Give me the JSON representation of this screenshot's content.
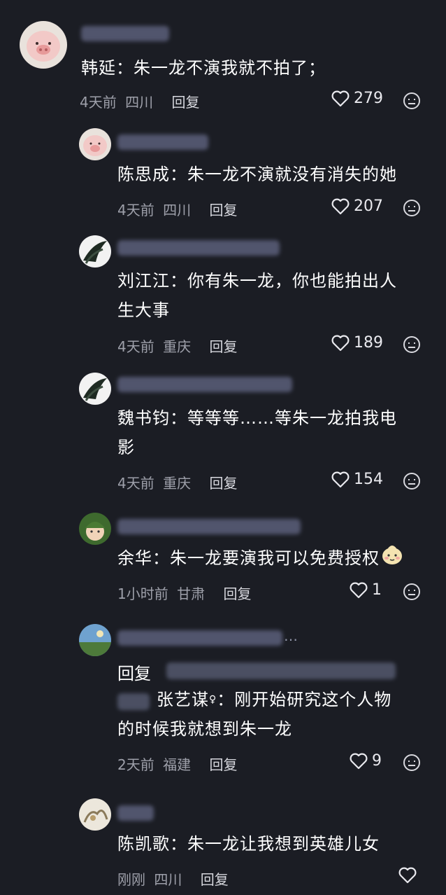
{
  "comments": [
    {
      "id": "c1",
      "text": "韩延：朱一龙不演我就不拍了；",
      "time": "4天前",
      "location": "四川",
      "reply": "回复",
      "likes": "279"
    },
    {
      "id": "c2",
      "text": "陈思成：朱一龙不演就没有消失的她",
      "time": "4天前",
      "location": "四川",
      "reply": "回复",
      "likes": "207"
    },
    {
      "id": "c3",
      "text_line1": "刘江江：你有朱一龙，你也能拍出人",
      "text_line2": "生大事",
      "time": "4天前",
      "location": "重庆",
      "reply": "回复",
      "likes": "189"
    },
    {
      "id": "c4",
      "text_line1": "魏书钧：等等等……等朱一龙拍我电",
      "text_line2": "影",
      "time": "4天前",
      "location": "重庆",
      "reply": "回复",
      "likes": "154"
    },
    {
      "id": "c5",
      "text": "余华：朱一龙要演我可以免费授权",
      "time": "1小时前",
      "location": "甘肃",
      "reply": "回复",
      "likes": "1"
    },
    {
      "id": "c6",
      "reply_prefix": "回复",
      "name": "张艺谋",
      "text_line1": "：刚开始研究这个人物",
      "text_line2": "的时候我就想到朱一龙",
      "time": "2天前",
      "location": "福建",
      "reply": "回复",
      "likes": "9"
    },
    {
      "id": "c7",
      "text": "陈凯歌：朱一龙让我想到英雄儿女",
      "time": "刚刚",
      "location": "四川",
      "reply": "回复"
    }
  ],
  "icons": {
    "like": "heart-outline-icon",
    "dislike": "frown-face-icon",
    "emoji": "shy-face-emoji"
  },
  "colors": {
    "background": "#1b1d24",
    "meta": "#9ea0aa",
    "text": "#ffffff"
  }
}
